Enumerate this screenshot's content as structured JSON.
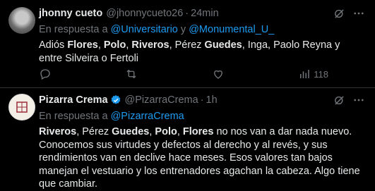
{
  "tweet1": {
    "name": "jhonny cueto",
    "handle": "@jhonnycueto26",
    "separator": "·",
    "time": "24min",
    "reply_prefix": "En respuesta a ",
    "reply_mention_1": "@Universitario",
    "reply_and": " y ",
    "reply_mention_2": "@Monumental_U_",
    "body": [
      {
        "t": "Adiós ",
        "b": false
      },
      {
        "t": "Flores",
        "b": true
      },
      {
        "t": ", ",
        "b": false
      },
      {
        "t": "Polo",
        "b": true
      },
      {
        "t": ", ",
        "b": false
      },
      {
        "t": "Riveros",
        "b": true
      },
      {
        "t": ", Pérez ",
        "b": false
      },
      {
        "t": "Guedes",
        "b": true
      },
      {
        "t": ", Inga, Paolo Reyna y entre Silveira o Fertoli",
        "b": false
      }
    ],
    "views": "118"
  },
  "tweet2": {
    "name": "Pizarra Crema",
    "handle": "@PizarraCrema",
    "separator": "·",
    "time": "1h",
    "reply_prefix": "En respuesta a ",
    "reply_mention_1": "@PizarraCrema",
    "body": [
      {
        "t": "Riveros",
        "b": true
      },
      {
        "t": ", Pérez ",
        "b": false
      },
      {
        "t": "Guedes",
        "b": true
      },
      {
        "t": ", ",
        "b": false
      },
      {
        "t": "Polo",
        "b": true
      },
      {
        "t": ", ",
        "b": false
      },
      {
        "t": "Flores",
        "b": true
      },
      {
        "t": " no nos van a dar nada nuevo. Conocemos sus virtudes y defectos al derecho y al revés, y sus rendimientos van en declive hace meses. Esos valores tan bajos manejan el vestuario y los entrenadores agachan la cabeza. Algo tiene que cambiar.",
        "b": false
      }
    ]
  },
  "colors": {
    "accent": "#1d9bf0",
    "muted": "#71767b",
    "text": "#e7e9ea",
    "bg": "#000000",
    "divider": "#2f3336"
  },
  "icons": [
    "grok-icon",
    "more-icon",
    "reply-icon",
    "retweet-icon",
    "like-icon",
    "views-icon",
    "verified-badge-icon"
  ]
}
